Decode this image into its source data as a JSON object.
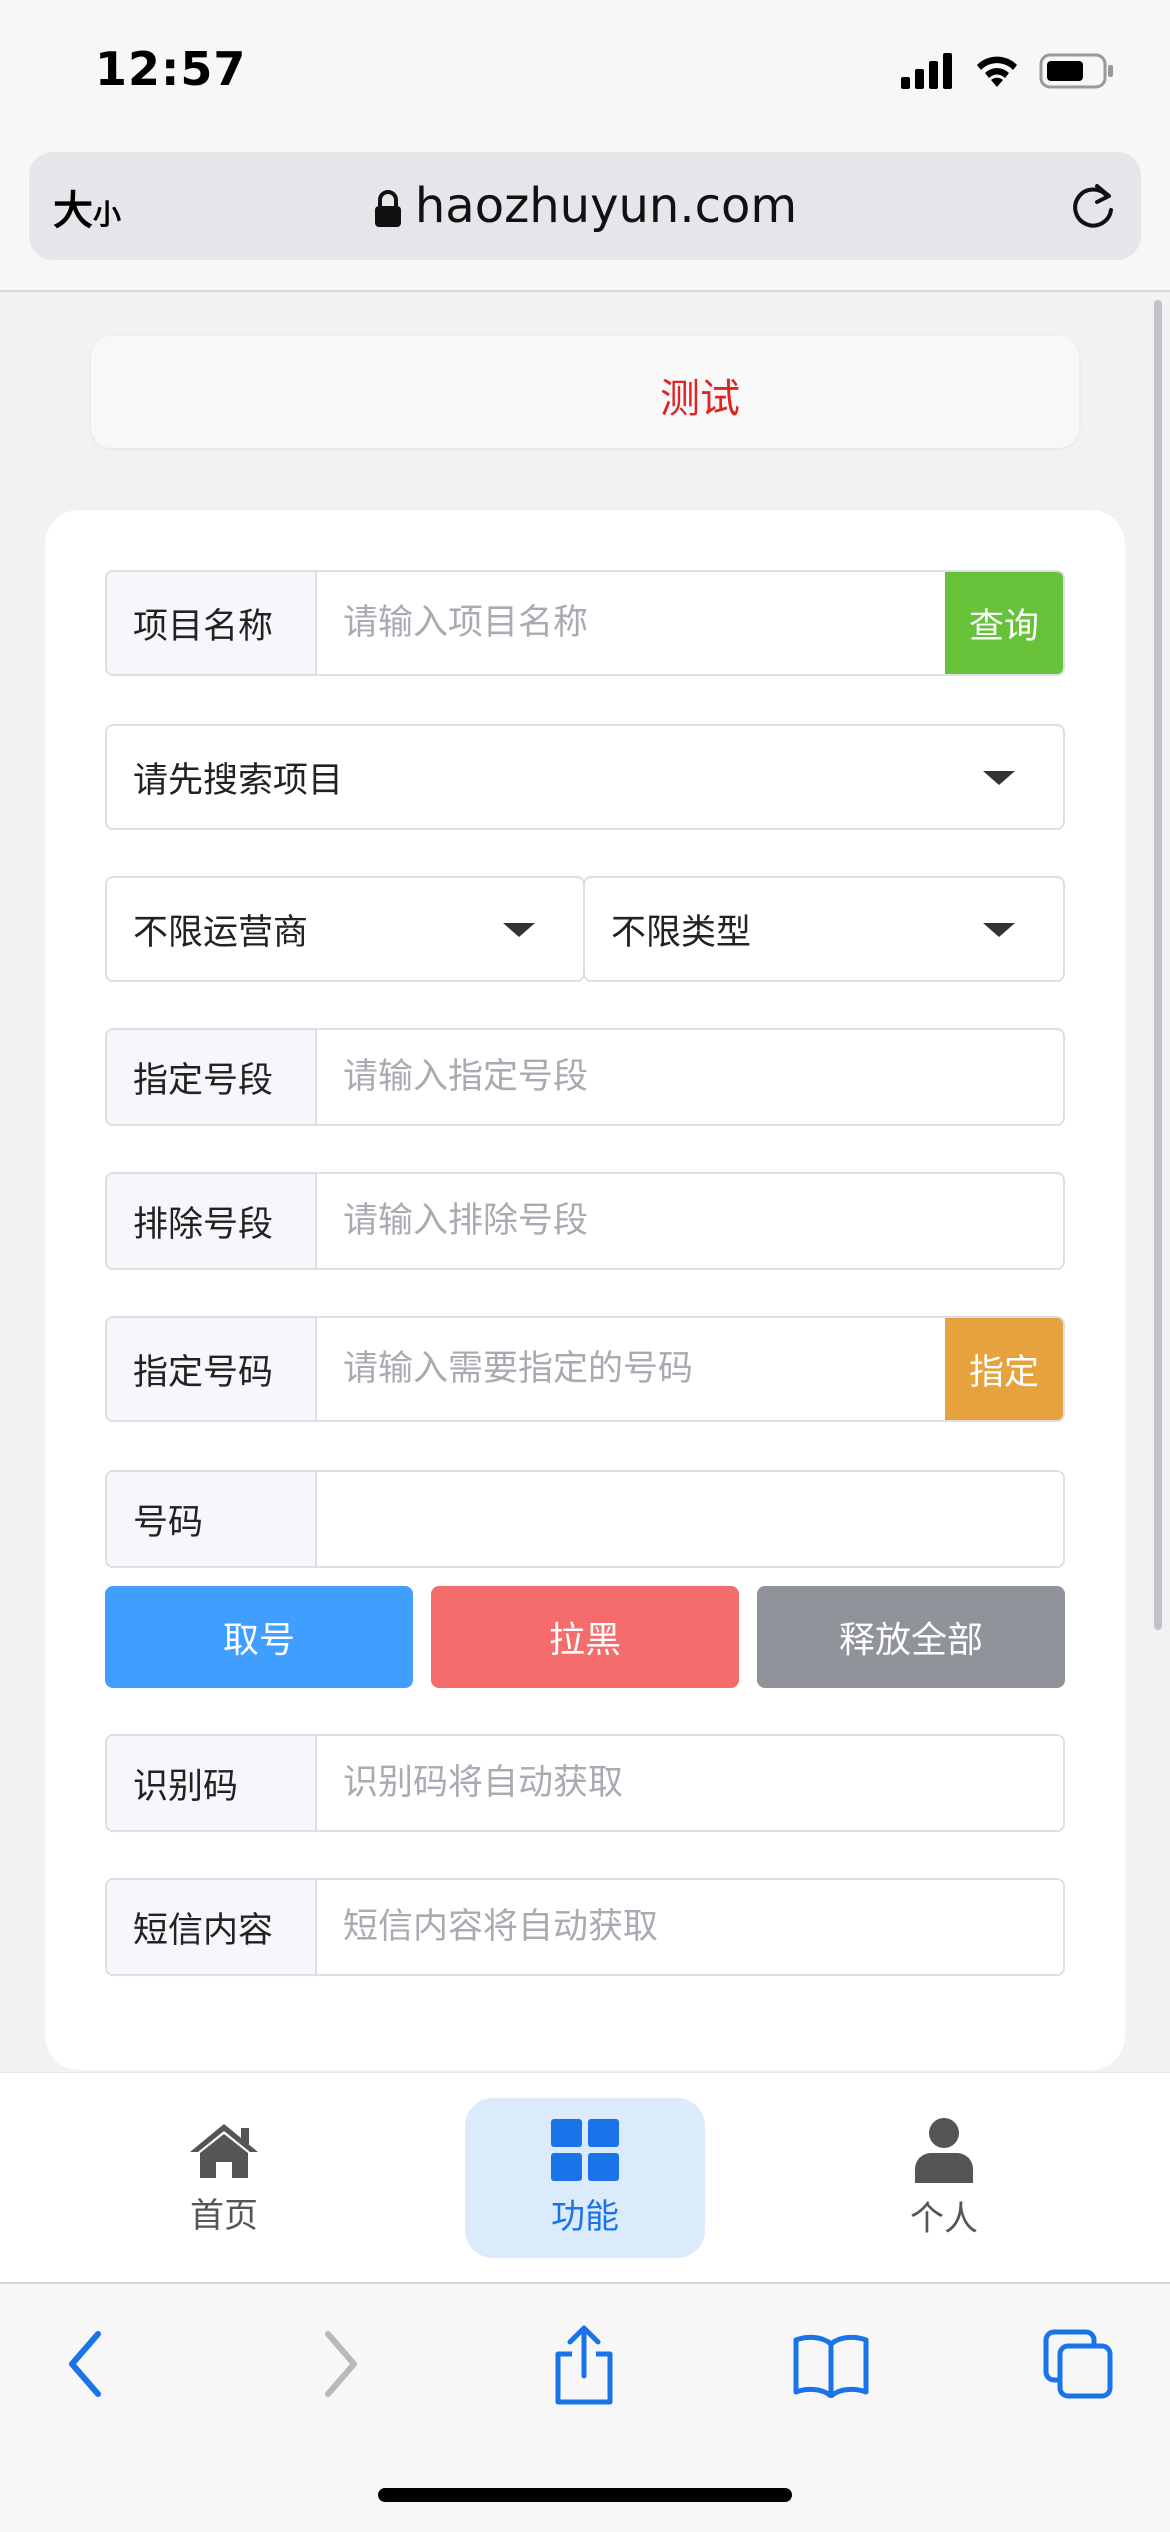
{
  "status_bar": {
    "time": "12:57"
  },
  "browser": {
    "text_size_big": "大",
    "text_size_small": "小",
    "url": "haozhuyun.com"
  },
  "notice": {
    "text": "测试"
  },
  "form": {
    "project_name": {
      "label": "项目名称",
      "placeholder": "请输入项目名称",
      "button": "查询"
    },
    "project_select": {
      "value": "请先搜索项目"
    },
    "operator_select": {
      "value": "不限运营商"
    },
    "type_select": {
      "value": "不限类型"
    },
    "specify_segment": {
      "label": "指定号段",
      "placeholder": "请输入指定号段"
    },
    "exclude_segment": {
      "label": "排除号段",
      "placeholder": "请输入排除号段"
    },
    "specify_number": {
      "label": "指定号码",
      "placeholder": "请输入需要指定的号码",
      "button": "指定"
    },
    "number": {
      "label": "号码",
      "value": ""
    },
    "actions": {
      "get_number": "取号",
      "blacklist": "拉黑",
      "release_all": "释放全部"
    },
    "code": {
      "label": "识别码",
      "placeholder": "识别码将自动获取"
    },
    "sms": {
      "label": "短信内容",
      "placeholder": "短信内容将自动获取"
    }
  },
  "app_nav": {
    "items": [
      {
        "label": "首页"
      },
      {
        "label": "功能"
      },
      {
        "label": "个人"
      }
    ]
  },
  "colors": {
    "query_green": "#67c23a",
    "specify_orange": "#e6a23c",
    "get_blue": "#409eff",
    "blacklist_red": "#f56c6c",
    "release_gray": "#909399",
    "notice_red": "#e02424",
    "safari_blue": "#1a73e8"
  }
}
